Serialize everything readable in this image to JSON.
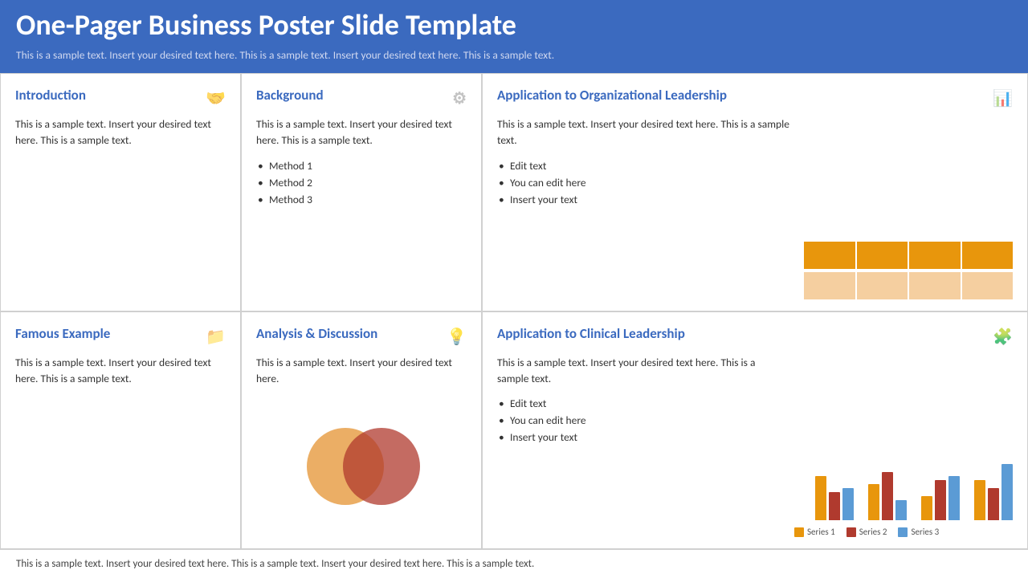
{
  "header": {
    "title": "One-Pager Business Poster Slide Template",
    "subtitle": "This is a sample text. Insert your desired text here. This is a sample text. Insert your desired text here. This is a sample text."
  },
  "cells": {
    "introduction": {
      "title": "Introduction",
      "icon_name": "handshake-icon",
      "body": "This is a sample text. Insert your desired text here. This is a sample text.",
      "list": []
    },
    "background": {
      "title": "Background",
      "icon_name": "gear-icon",
      "body": "This is a sample text. Insert your desired text here. This is a sample text.",
      "list": [
        "Method 1",
        "Method 2",
        "Method 3"
      ]
    },
    "org_leadership": {
      "title": "Application to Organizational Leadership",
      "icon_name": "barchart-icon",
      "body": "This is a sample text. Insert your desired text here. This is a sample text.",
      "list": [
        "Edit text",
        "You can edit here",
        "Insert your text"
      ],
      "chart": {
        "rows": [
          "top",
          "bot"
        ],
        "segments": 4
      }
    },
    "famous_example": {
      "title": "Famous Example",
      "icon_name": "folder-icon",
      "body": "This is a sample text. Insert your desired text here. This is a sample text.",
      "list": []
    },
    "analysis": {
      "title": "Analysis & Discussion",
      "icon_name": "bulb-icon",
      "body": "This is a sample text. Insert your desired text here.",
      "list": []
    },
    "clinical_leadership": {
      "title": "Application to Clinical Leadership",
      "icon_name": "puzzle-icon",
      "body": "This is a sample text. Insert your desired text here. This is a sample text.",
      "list": [
        "Edit text",
        "You can edit here",
        "Insert your text"
      ],
      "chart": {
        "legend": [
          "Series 1",
          "Series 2",
          "Series 3"
        ],
        "colors": [
          "#e8960c",
          "#b03a2e",
          "#5b9bd5"
        ],
        "groups": [
          {
            "bars": [
              55,
              35,
              40
            ]
          },
          {
            "bars": [
              45,
              60,
              25
            ]
          },
          {
            "bars": [
              30,
              50,
              55
            ]
          },
          {
            "bars": [
              50,
              40,
              70
            ]
          }
        ]
      }
    }
  },
  "footer": {
    "text": "This is a sample text. Insert your desired text here. This is a sample text. Insert your desired text here. This is a sample text."
  }
}
